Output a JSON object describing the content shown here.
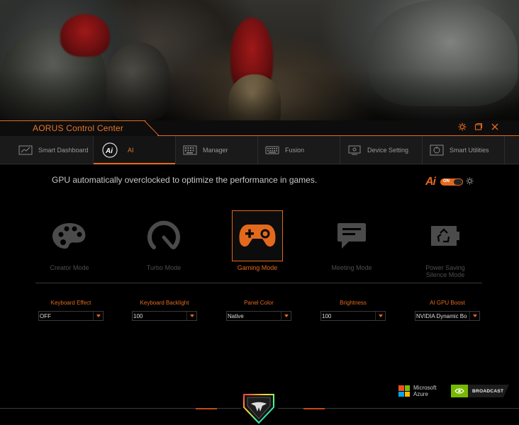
{
  "app": {
    "title": "AORUS Control Center"
  },
  "window_controls": {
    "settings_icon": "gear-icon",
    "restore_icon": "restore-icon",
    "close_icon": "close-icon"
  },
  "nav": {
    "items": [
      {
        "label": "Smart Dashboard",
        "icon": "dashboard-icon"
      },
      {
        "label": "AI",
        "icon": "ai-icon",
        "active": true
      },
      {
        "label": "Manager",
        "icon": "keyboard-grid-icon"
      },
      {
        "label": "Fusion",
        "icon": "keyboard-icon"
      },
      {
        "label": "Device Setting",
        "icon": "monitor-icon"
      },
      {
        "label": "Smart Utilities",
        "icon": "utilities-icon"
      }
    ]
  },
  "main": {
    "description": "GPU automatically overclocked to optimize the performance in games.",
    "ai_toggle": {
      "logo": "Ai",
      "state": "ON"
    },
    "modes": [
      {
        "label": "Creator Mode",
        "icon": "palette-icon"
      },
      {
        "label": "Turbo Mode",
        "icon": "speedometer-icon"
      },
      {
        "label": "Gaming Mode",
        "icon": "gamepad-icon",
        "selected": true
      },
      {
        "label": "Meeting Mode",
        "icon": "chat-icon"
      },
      {
        "label": "Power Saving Silence Mode",
        "icon": "battery-recycle-icon"
      }
    ],
    "settings": [
      {
        "label": "Keyboard Effect",
        "value": "OFF"
      },
      {
        "label": "Keyboard Backlight",
        "value": "100"
      },
      {
        "label": "Panel Color",
        "value": "Native"
      },
      {
        "label": "Brightness",
        "value": "100"
      },
      {
        "label": "AI GPU Boost",
        "value": "NVIDIA Dynamic Bo"
      }
    ],
    "badges": {
      "microsoft_line1": "Microsoft",
      "microsoft_line2": "Azure",
      "nvidia": "BROADCAST"
    }
  },
  "colors": {
    "accent": "#e3691d",
    "background": "#000000",
    "navbar": "#1a1a1a"
  }
}
